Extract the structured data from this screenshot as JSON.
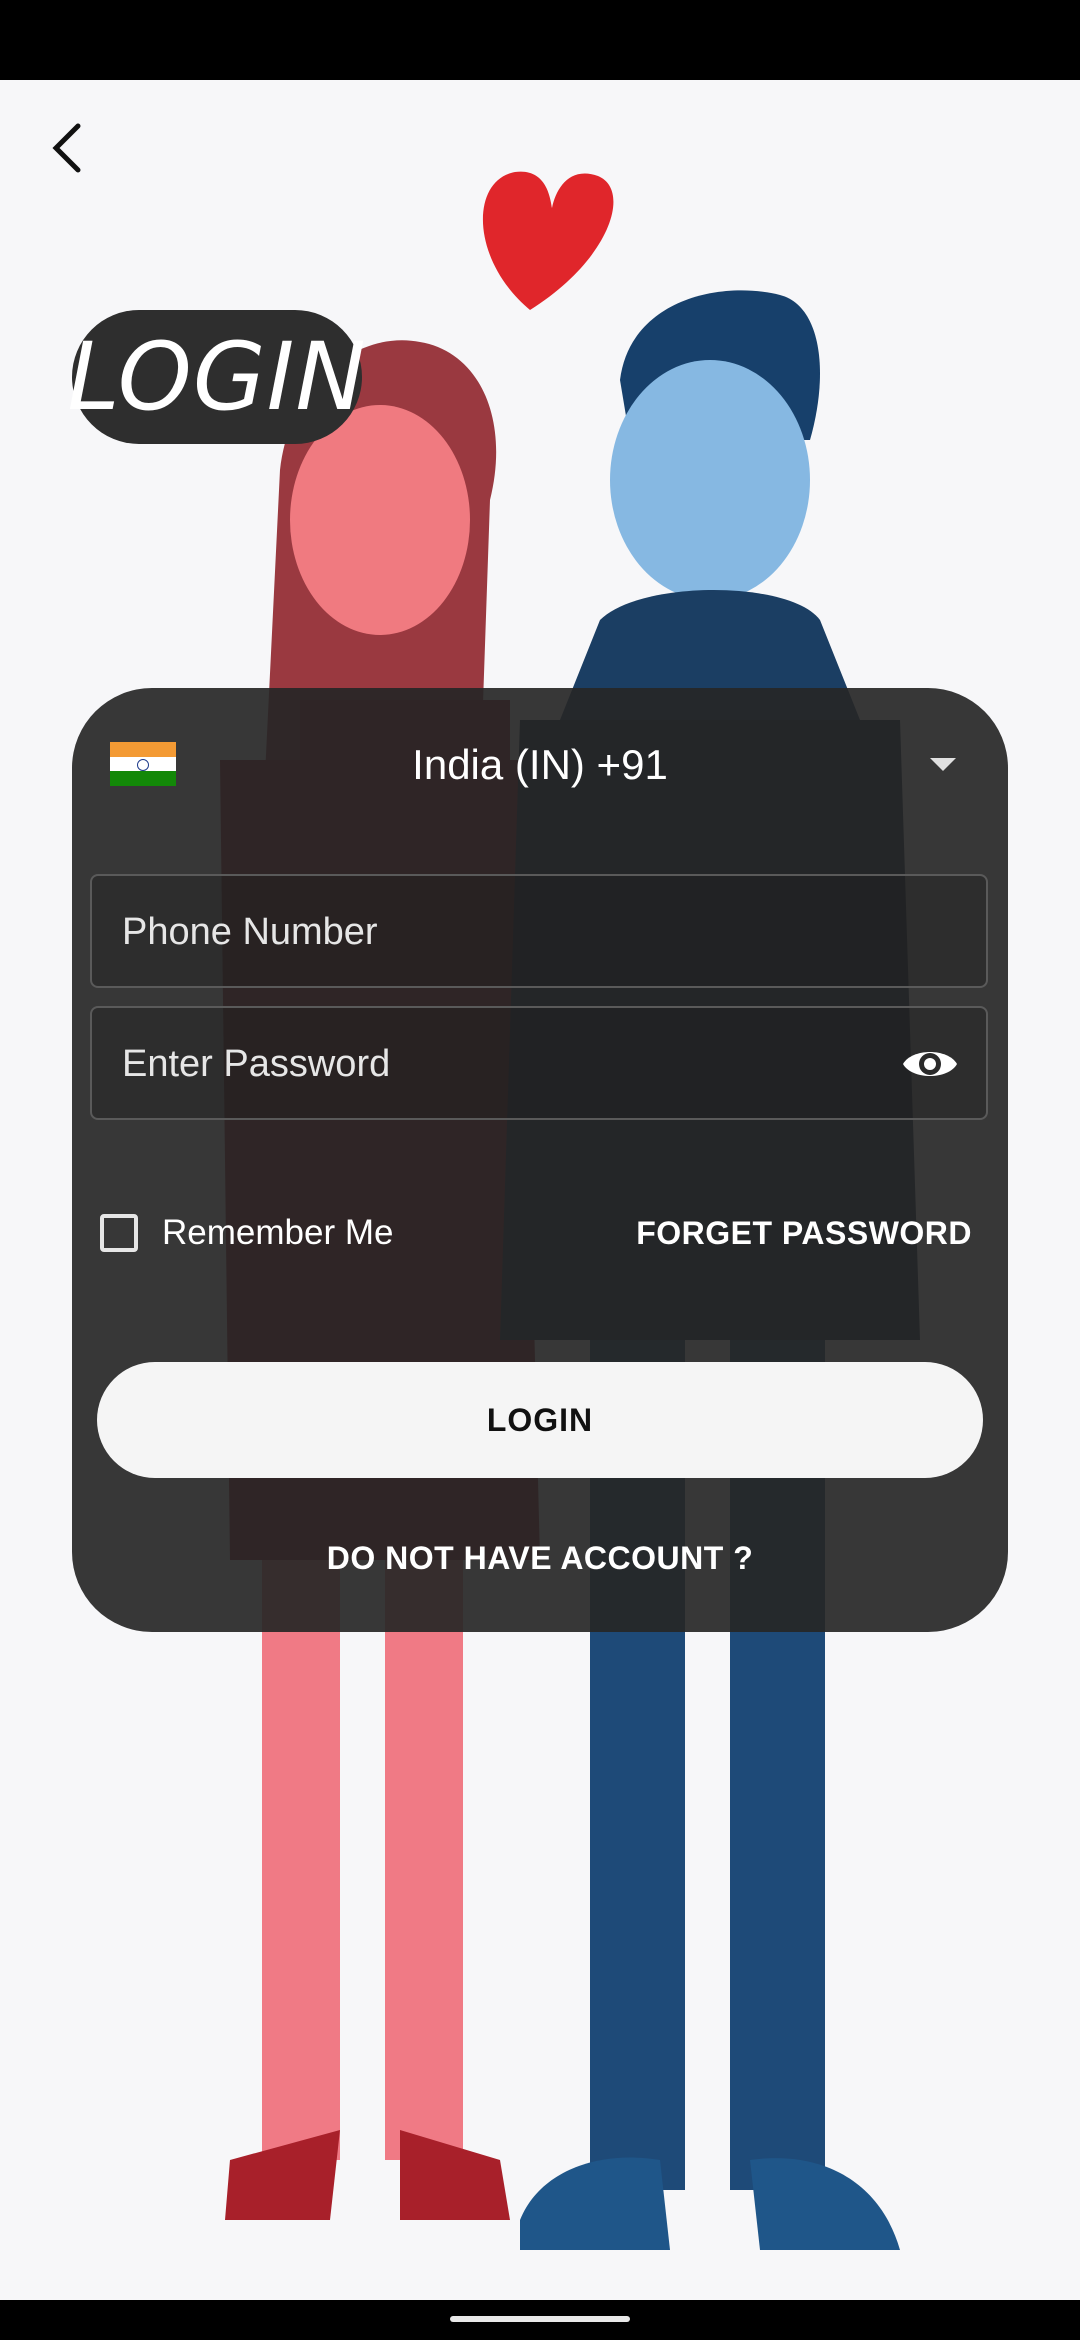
{
  "header": {
    "title": "LOGIN"
  },
  "country": {
    "flag": "india-flag",
    "label": "India (IN)  +91"
  },
  "fields": {
    "phone_placeholder": "Phone Number",
    "password_placeholder": "Enter Password"
  },
  "options": {
    "remember_label": "Remember Me",
    "forget_label": "FORGET PASSWORD"
  },
  "actions": {
    "login_label": "LOGIN",
    "signup_label": "DO NOT HAVE ACCOUNT ?"
  },
  "colors": {
    "card": "#262626",
    "woman": "#e8606a",
    "man": "#2f6fa8",
    "heart": "#e0262b"
  }
}
